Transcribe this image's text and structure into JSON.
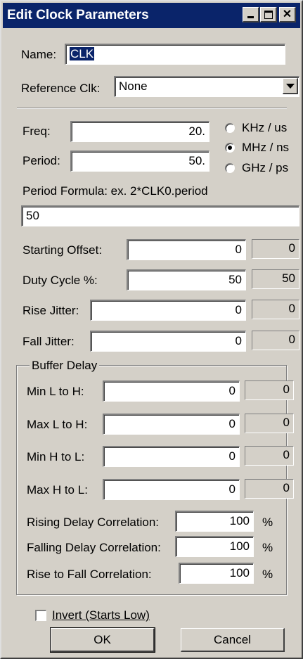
{
  "window": {
    "title": "Edit Clock Parameters",
    "controls": [
      "minimize-icon",
      "maximize-icon",
      "close-icon"
    ]
  },
  "name": {
    "label": "Name:",
    "value": "CLK"
  },
  "reference": {
    "label": "Reference Clk:",
    "value": "None"
  },
  "freq": {
    "label": "Freq:",
    "value": "20."
  },
  "period": {
    "label": "Period:",
    "value": "50."
  },
  "units": {
    "options": [
      "KHz / us",
      "MHz / ns",
      "GHz / ps"
    ],
    "selected": "MHz / ns"
  },
  "formula": {
    "label": "Period Formula: ex. 2*CLK0.period",
    "value": "50"
  },
  "params": [
    {
      "label": "Starting Offset:",
      "value": "0",
      "computed": "0"
    },
    {
      "label": "Duty Cycle %:",
      "value": "50",
      "computed": "50"
    },
    {
      "label": "Rise Jitter:",
      "value": "0",
      "computed": "0"
    },
    {
      "label": "Fall Jitter:",
      "value": "0",
      "computed": "0"
    }
  ],
  "buffer_delay": {
    "label": "Buffer Delay",
    "rows": [
      {
        "label": "Min L to H:",
        "value": "0",
        "computed": "0"
      },
      {
        "label": "Max L to H:",
        "value": "0",
        "computed": "0"
      },
      {
        "label": "Min H to L:",
        "value": "0",
        "computed": "0"
      },
      {
        "label": "Max H to L:",
        "value": "0",
        "computed": "0"
      }
    ],
    "correlations": [
      {
        "label": "Rising Delay Correlation:",
        "value": "100",
        "unit": "%"
      },
      {
        "label": "Falling Delay Correlation:",
        "value": "100",
        "unit": "%"
      },
      {
        "label": "Rise to Fall Correlation:",
        "value": "100",
        "unit": "%"
      }
    ]
  },
  "invert": {
    "label": "Invert (Starts Low)",
    "checked": false
  },
  "buttons": {
    "ok": "OK",
    "cancel": "Cancel"
  }
}
